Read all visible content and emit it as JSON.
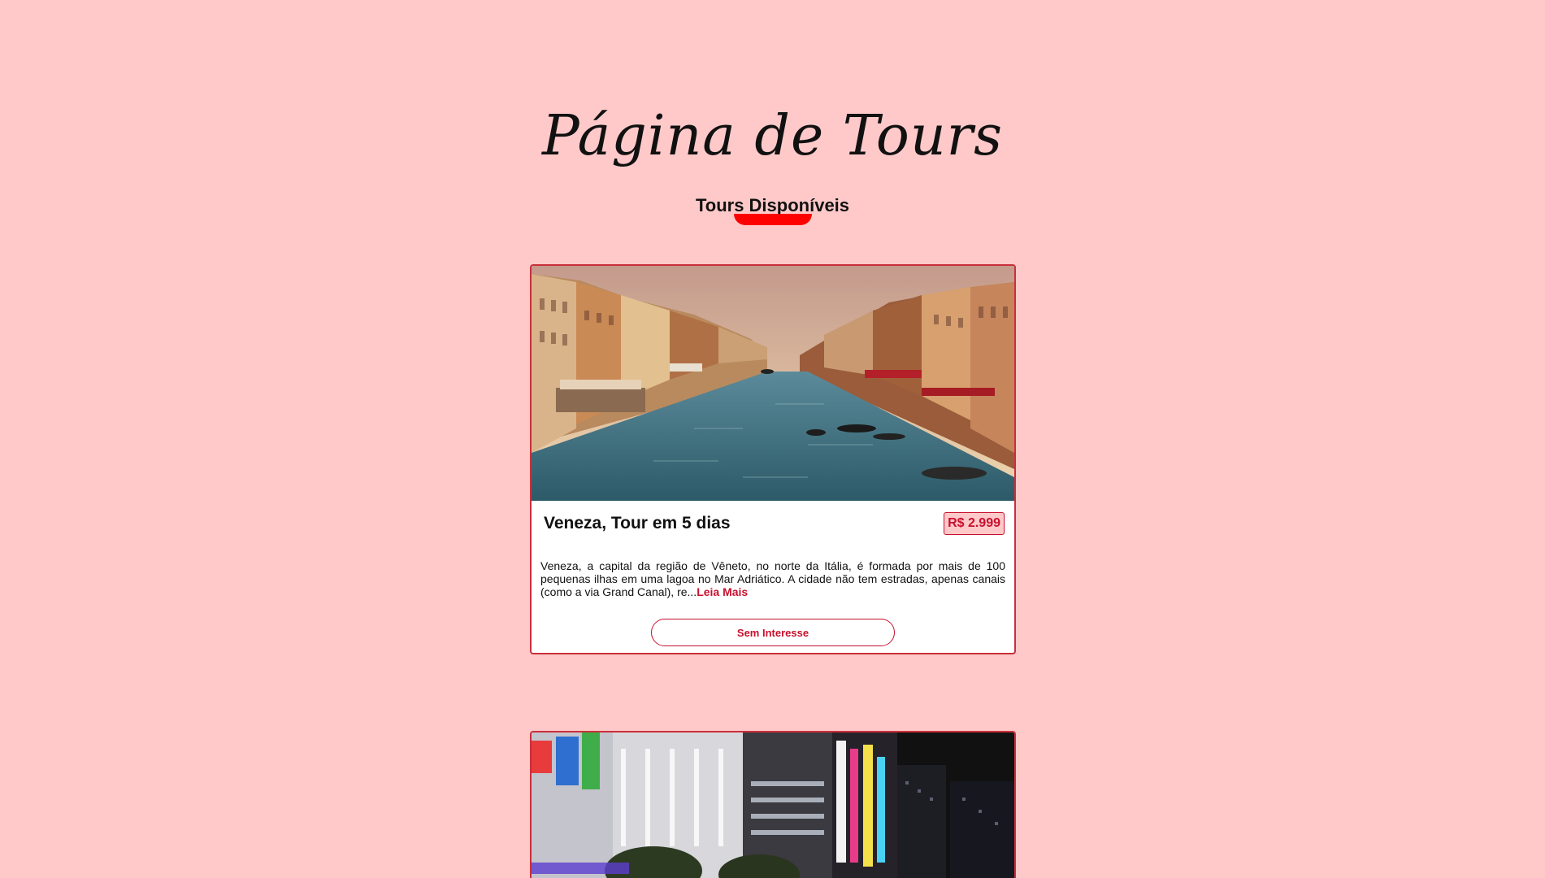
{
  "page": {
    "title": "Página de Tours",
    "subtitle": "Tours Disponíveis"
  },
  "tours": [
    {
      "title": "Veneza, Tour em 5 dias",
      "price": "R$ 2.999",
      "description": "Veneza, a capital da região de Vêneto, no norte da Itália, é formada por mais de 100 pequenas ilhas em uma lagoa no Mar Adriático. A cidade não tem estradas, apenas canais (como a via Grand Canal), re...",
      "read_more": "Leia Mais",
      "button": "Sem Interesse",
      "image": "venice-grand-canal-photo"
    },
    {
      "image": "tokyo-street-night-photo"
    }
  ],
  "colors": {
    "background": "#ffc9c9",
    "accent": "#c8102e",
    "underline": "#ff0000"
  }
}
